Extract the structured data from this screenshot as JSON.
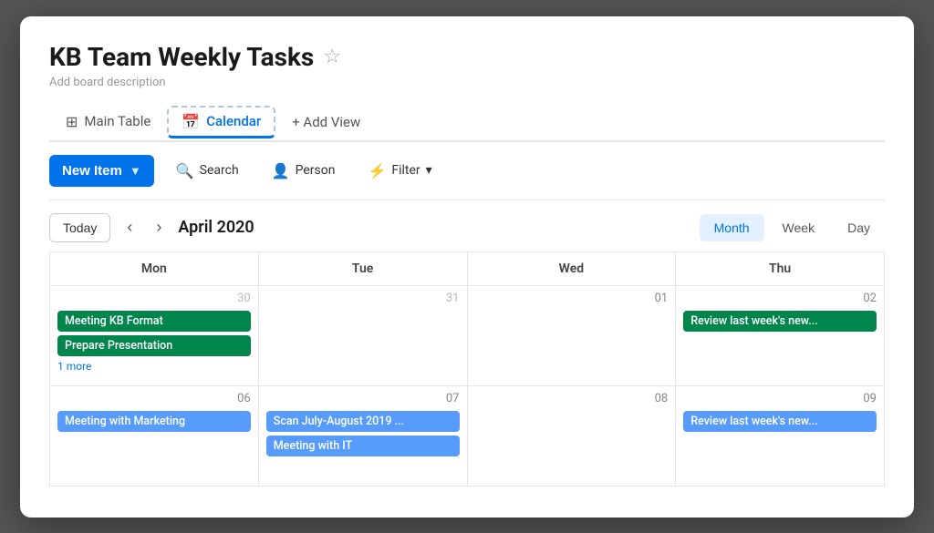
{
  "app": {
    "title": "KB Team Weekly Tasks",
    "subtitle": "Add board description"
  },
  "tabs": [
    {
      "id": "main-table",
      "label": "Main Table",
      "icon": "⊞",
      "active": false
    },
    {
      "id": "calendar",
      "label": "Calendar",
      "icon": "📅",
      "active": true
    }
  ],
  "add_view_label": "+ Add View",
  "toolbar": {
    "new_item_label": "New Item",
    "search_label": "Search",
    "person_label": "Person",
    "filter_label": "Filter"
  },
  "calendar": {
    "today_label": "Today",
    "month_label": "April 2020",
    "view_buttons": [
      "Month",
      "Week",
      "Day"
    ],
    "active_view": "Month",
    "day_headers": [
      "Mon",
      "Tue",
      "Wed",
      "Thu"
    ],
    "weeks": [
      {
        "days": [
          {
            "num": "30",
            "other": true,
            "events": [
              {
                "label": "Meeting KB Format",
                "type": "green"
              },
              {
                "label": "Prepare Presentation",
                "type": "green"
              }
            ],
            "more": "1 more"
          },
          {
            "num": "31",
            "other": true,
            "events": []
          },
          {
            "num": "01",
            "other": false,
            "events": []
          },
          {
            "num": "02",
            "other": false,
            "events": [
              {
                "label": "Review last week's new...",
                "type": "green"
              }
            ]
          }
        ]
      },
      {
        "days": [
          {
            "num": "06",
            "other": false,
            "events": [
              {
                "label": "Meeting with Marketing",
                "type": "blue"
              }
            ]
          },
          {
            "num": "07",
            "other": false,
            "events": [
              {
                "label": "Scan July-August 2019 ...",
                "type": "blue"
              },
              {
                "label": "Meeting with IT",
                "type": "blue"
              }
            ]
          },
          {
            "num": "08",
            "other": false,
            "events": []
          },
          {
            "num": "09",
            "other": false,
            "events": [
              {
                "label": "Review last week's new...",
                "type": "blue"
              }
            ]
          }
        ]
      }
    ]
  }
}
